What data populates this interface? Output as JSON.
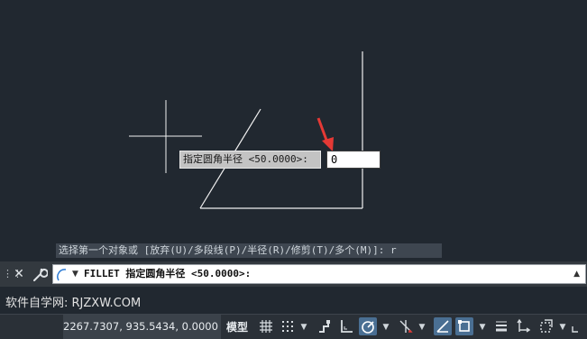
{
  "canvas": {
    "dynamic_prompt_label": "指定圆角半径 <50.0000>:",
    "dynamic_input_value": "0",
    "history_line": "选择第一个对象或 [放弃(U)/多段线(P)/半径(R)/修剪(T)/多个(M)]: r"
  },
  "command_line": {
    "text": "FILLET 指定圆角半径 <50.0000>:",
    "grip_icon": "grip-icon",
    "close_icon": "close-icon",
    "customize_icon": "wrench-icon"
  },
  "watermark": "软件自学网: RJZXW.COM",
  "statusbar": {
    "coordinates": "2267.7307, 935.5434, 0.0000",
    "model_label": "模型",
    "icons": [
      "grid-icon",
      "snap-icon",
      "infer-icon",
      "ortho-icon",
      "polar-icon",
      "isodraft-icon",
      "object-snap-tracking-icon",
      "object-snap-icon",
      "lineweight-icon",
      "transparency-icon",
      "selection-cycling-icon",
      "3d-object-snap-icon"
    ]
  },
  "colors": {
    "canvas_bg": "#212830",
    "geometry": "#f0f0f0",
    "arrow": "#e53935",
    "active_toggle": "#4a6f93"
  }
}
